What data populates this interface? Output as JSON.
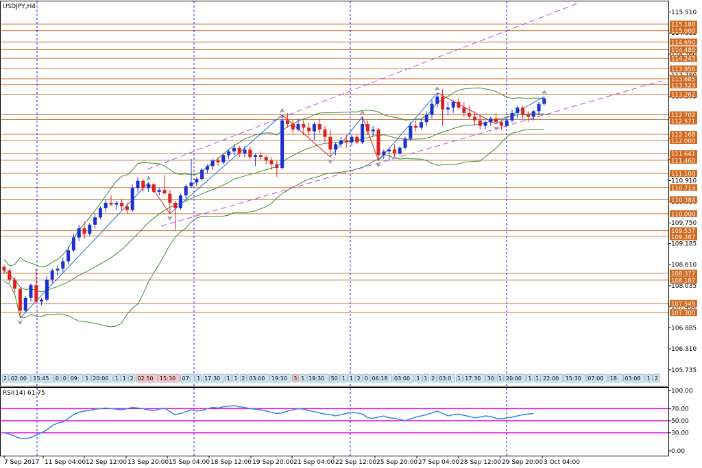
{
  "window": {
    "title": "USDJPY,H4",
    "rsi_label": "RSI(14) 61.75"
  },
  "colors": {
    "level_line": "#c87533",
    "level_label_bg": "#d2691e",
    "bull": "#1a2fd6",
    "bear": "#e0201f",
    "bands": "#3a8a2e",
    "channel": "#b04fd8",
    "zigzag_up": "#1e6fe0",
    "zigzag_down": "#d62020",
    "rsi": "#2f86e0",
    "rsi_levels": "#e000e0",
    "period_sep": "#1a1adc"
  },
  "chart_data": [
    {
      "type": "candlestick",
      "symbol": "USDJPY",
      "timeframe": "H4",
      "ylim": [
        105.3,
        115.8
      ],
      "y_ticks": [
        "115.510",
        "114.935",
        "114.360",
        "113.780",
        "113.205",
        "112.630",
        "112.055",
        "111.480",
        "110.910",
        "110.330",
        "109.750",
        "109.185",
        "108.610",
        "108.035",
        "107.460",
        "106.885",
        "106.310",
        "105.735"
      ],
      "x_ticks": [
        "7 Sep 2017",
        "11 Sep 04:00",
        "12 Sep 12:00",
        "13 Sep 20:00",
        "15 Sep 04:00",
        "18 Sep 12:00",
        "19 Sep 20:00",
        "21 Sep 04:00",
        "22 Sep 12:00",
        "25 Sep 20:00",
        "27 Sep 04:00",
        "28 Sep 12:00",
        "29 Sep 20:00",
        "3 Oct 04:00"
      ],
      "level_labels": [
        "115.180",
        "115.000",
        "114.690",
        "114.480",
        "114.243",
        "113.956",
        "113.685",
        "113.523",
        "113.262",
        "112.702",
        "112.571",
        "112.168",
        "112.000",
        "111.641",
        "111.460",
        "111.100",
        "110.713",
        "110.384",
        "110.000",
        "109.537",
        "109.387",
        "108.377",
        "108.187",
        "107.549",
        "107.300"
      ],
      "event_tags": [
        {
          "text": "2",
          "hi": false
        },
        {
          "text": "02:00",
          "hi": false
        },
        {
          "text": "15:45",
          "hi": false
        },
        {
          "text": "0",
          "hi": false
        },
        {
          "text": "0",
          "hi": false
        },
        {
          "text": "09:",
          "hi": false
        },
        {
          "text": "1",
          "hi": false
        },
        {
          "text": "20:00",
          "hi": false
        },
        {
          "text": "1",
          "hi": false
        },
        {
          "text": "1",
          "hi": false
        },
        {
          "text": "2",
          "hi": false
        },
        {
          "text": "02:50",
          "hi": true
        },
        {
          "text": "15:30",
          "hi": true
        },
        {
          "text": "07:",
          "hi": false
        },
        {
          "text": "1",
          "hi": false
        },
        {
          "text": "17:30",
          "hi": false
        },
        {
          "text": "1",
          "hi": false
        },
        {
          "text": "1",
          "hi": false
        },
        {
          "text": "2",
          "hi": false
        },
        {
          "text": "03:00",
          "hi": false
        },
        {
          "text": "19:30",
          "hi": false
        },
        {
          "text": "3",
          "hi": true
        },
        {
          "text": "1",
          "hi": false
        },
        {
          "text": "19:30",
          "hi": false
        },
        {
          "text": "50",
          "hi": false
        },
        {
          "text": "1",
          "hi": false
        },
        {
          "text": "1",
          "hi": false
        },
        {
          "text": "2",
          "hi": false
        },
        {
          "text": "0",
          "hi": false
        },
        {
          "text": "06:18",
          "hi": false
        },
        {
          "text": "03:00",
          "hi": false
        },
        {
          "text": "1",
          "hi": false
        },
        {
          "text": "1",
          "hi": false
        },
        {
          "text": "2",
          "hi": false
        },
        {
          "text": "03:0",
          "hi": false
        },
        {
          "text": "1",
          "hi": false
        },
        {
          "text": "17:30",
          "hi": false
        },
        {
          "text": "30",
          "hi": false
        },
        {
          "text": "1",
          "hi": false
        },
        {
          "text": "20:00",
          "hi": false
        },
        {
          "text": "1",
          "hi": false
        },
        {
          "text": "1",
          "hi": false
        },
        {
          "text": "22:00",
          "hi": false
        },
        {
          "text": "15:30",
          "hi": false
        },
        {
          "text": "07:00",
          "hi": false
        },
        {
          "text": "18:",
          "hi": false
        },
        {
          "text": "03:08",
          "hi": false
        },
        {
          "text": "1",
          "hi": false
        },
        {
          "text": "2",
          "hi": false
        },
        {
          "text": "03:08",
          "hi": false
        },
        {
          "text": "1",
          "hi": false
        },
        {
          "text": "23:30",
          "hi": false
        },
        {
          "text": "1",
          "hi": false
        },
        {
          "text": "2",
          "hi": false
        },
        {
          "text": "02:50",
          "hi": false
        },
        {
          "text": "17:",
          "hi": false
        },
        {
          "text": "03:08",
          "hi": false
        },
        {
          "text": "1",
          "hi": false
        },
        {
          "text": "22",
          "hi": false
        }
      ],
      "candles": [
        [
          108.55,
          108.6,
          108.35,
          108.45
        ],
        [
          108.45,
          108.5,
          108.1,
          108.2
        ],
        [
          108.2,
          108.25,
          107.85,
          107.95
        ],
        [
          107.95,
          108.0,
          107.15,
          107.35
        ],
        [
          107.35,
          107.75,
          107.3,
          107.7
        ],
        [
          107.7,
          108.1,
          107.6,
          108.05
        ],
        [
          108.05,
          108.5,
          107.95,
          107.6
        ],
        [
          107.6,
          107.7,
          107.5,
          107.65
        ],
        [
          107.65,
          108.3,
          107.6,
          108.2
        ],
        [
          108.2,
          108.5,
          108.1,
          108.45
        ],
        [
          108.45,
          108.6,
          108.3,
          108.5
        ],
        [
          108.5,
          108.8,
          108.4,
          108.7
        ],
        [
          108.7,
          109.1,
          108.6,
          109.0
        ],
        [
          109.0,
          109.45,
          108.95,
          109.35
        ],
        [
          109.35,
          109.7,
          109.25,
          109.6
        ],
        [
          109.6,
          109.8,
          109.3,
          109.45
        ],
        [
          109.45,
          109.75,
          109.4,
          109.7
        ],
        [
          109.7,
          110.0,
          109.6,
          109.9
        ],
        [
          109.9,
          110.2,
          109.85,
          110.15
        ],
        [
          110.15,
          110.4,
          110.05,
          110.3
        ],
        [
          110.3,
          110.5,
          110.2,
          110.25
        ],
        [
          110.25,
          110.35,
          110.1,
          110.3
        ],
        [
          110.3,
          110.4,
          110.1,
          110.2
        ],
        [
          110.2,
          110.3,
          110.0,
          110.1
        ],
        [
          110.1,
          110.8,
          110.05,
          110.7
        ],
        [
          110.7,
          111.0,
          110.6,
          110.9
        ],
        [
          110.9,
          110.95,
          110.6,
          110.7
        ],
        [
          110.7,
          110.85,
          110.6,
          110.8
        ],
        [
          110.8,
          110.85,
          110.55,
          110.6
        ],
        [
          110.6,
          110.7,
          110.5,
          110.65
        ],
        [
          110.65,
          111.05,
          110.55,
          110.55
        ],
        [
          110.55,
          110.65,
          110.0,
          110.3
        ],
        [
          110.3,
          110.35,
          109.55,
          110.15
        ],
        [
          110.15,
          110.55,
          110.1,
          110.5
        ],
        [
          110.5,
          110.8,
          110.4,
          110.75
        ],
        [
          110.75,
          111.5,
          110.7,
          110.85
        ],
        [
          110.85,
          111.0,
          110.75,
          110.95
        ],
        [
          110.95,
          111.25,
          110.9,
          111.2
        ],
        [
          111.2,
          111.35,
          111.1,
          111.3
        ],
        [
          111.3,
          111.5,
          111.2,
          111.45
        ],
        [
          111.45,
          111.55,
          111.3,
          111.4
        ],
        [
          111.4,
          111.65,
          111.35,
          111.6
        ],
        [
          111.6,
          111.75,
          111.5,
          111.7
        ],
        [
          111.7,
          111.9,
          111.6,
          111.8
        ],
        [
          111.8,
          111.85,
          111.55,
          111.65
        ],
        [
          111.65,
          111.85,
          111.55,
          111.75
        ],
        [
          111.75,
          111.85,
          111.5,
          111.55
        ],
        [
          111.55,
          111.65,
          111.3,
          111.6
        ],
        [
          111.6,
          111.7,
          111.5,
          111.55
        ],
        [
          111.55,
          111.6,
          111.35,
          111.45
        ],
        [
          111.45,
          111.55,
          111.2,
          111.35
        ],
        [
          111.35,
          111.45,
          111.0,
          111.25
        ],
        [
          111.25,
          112.7,
          111.2,
          112.55
        ],
        [
          112.55,
          112.75,
          112.35,
          112.45
        ],
        [
          112.45,
          112.55,
          112.2,
          112.3
        ],
        [
          112.3,
          112.6,
          112.25,
          112.45
        ],
        [
          112.45,
          112.6,
          112.15,
          112.35
        ],
        [
          112.35,
          112.5,
          112.1,
          112.25
        ],
        [
          112.25,
          112.5,
          112.0,
          112.45
        ],
        [
          112.45,
          112.6,
          112.2,
          112.3
        ],
        [
          112.3,
          112.4,
          111.95,
          112.1
        ],
        [
          112.1,
          112.3,
          111.55,
          111.75
        ],
        [
          111.75,
          111.95,
          111.6,
          111.9
        ],
        [
          111.9,
          112.1,
          111.8,
          112.0
        ],
        [
          112.0,
          112.15,
          111.8,
          111.95
        ],
        [
          111.95,
          112.15,
          111.85,
          112.1
        ],
        [
          112.1,
          112.15,
          111.9,
          111.95
        ],
        [
          111.95,
          112.65,
          111.9,
          112.45
        ],
        [
          112.45,
          112.55,
          112.15,
          112.25
        ],
        [
          112.25,
          112.4,
          112.1,
          112.3
        ],
        [
          112.3,
          112.35,
          111.45,
          111.6
        ],
        [
          111.6,
          111.75,
          111.5,
          111.7
        ],
        [
          111.7,
          111.8,
          111.45,
          111.75
        ],
        [
          111.75,
          111.9,
          111.55,
          111.65
        ],
        [
          111.65,
          111.85,
          111.6,
          111.8
        ],
        [
          111.8,
          112.1,
          111.75,
          112.05
        ],
        [
          112.05,
          112.5,
          112.0,
          112.4
        ],
        [
          112.4,
          112.55,
          112.25,
          112.35
        ],
        [
          112.35,
          112.6,
          112.3,
          112.5
        ],
        [
          112.5,
          112.8,
          112.4,
          112.7
        ],
        [
          112.7,
          113.1,
          112.6,
          113.0
        ],
        [
          113.0,
          113.3,
          112.9,
          113.2
        ],
        [
          113.2,
          113.4,
          112.4,
          112.85
        ],
        [
          112.85,
          113.05,
          112.7,
          112.9
        ],
        [
          112.9,
          113.1,
          112.75,
          113.05
        ],
        [
          113.05,
          113.15,
          112.85,
          112.9
        ],
        [
          112.9,
          113.05,
          112.65,
          112.75
        ],
        [
          112.75,
          112.95,
          112.6,
          112.65
        ],
        [
          112.65,
          112.8,
          112.4,
          112.55
        ],
        [
          112.55,
          112.7,
          112.3,
          112.4
        ],
        [
          112.4,
          112.55,
          112.3,
          112.5
        ],
        [
          112.5,
          112.65,
          112.4,
          112.6
        ],
        [
          112.6,
          112.75,
          112.45,
          112.5
        ],
        [
          112.5,
          112.55,
          112.3,
          112.4
        ],
        [
          112.4,
          112.6,
          112.35,
          112.55
        ],
        [
          112.55,
          112.85,
          112.5,
          112.75
        ],
        [
          112.75,
          112.95,
          112.6,
          112.9
        ],
        [
          112.9,
          112.95,
          112.6,
          112.7
        ],
        [
          112.7,
          112.8,
          112.5,
          112.65
        ],
        [
          112.65,
          112.85,
          112.55,
          112.8
        ],
        [
          112.8,
          113.05,
          112.7,
          113.0
        ],
        [
          113.0,
          113.2,
          112.95,
          113.15
        ]
      ],
      "series": [
        {
          "name": "Bollinger upper"
        },
        {
          "name": "Bollinger middle"
        },
        {
          "name": "Bollinger lower"
        }
      ],
      "channel_lines": [
        "upper",
        "lower"
      ],
      "horizontal_levels": [
        115.18,
        115.0,
        114.69,
        114.48,
        114.243,
        113.956,
        113.685,
        113.523,
        113.262,
        112.702,
        112.571,
        112.168,
        112.0,
        111.641,
        111.46,
        111.1,
        110.713,
        110.384,
        110.0,
        109.537,
        109.387,
        108.377,
        108.187,
        107.549,
        107.3
      ]
    },
    {
      "type": "line",
      "name": "RSI(14)",
      "ylim": [
        0,
        100
      ],
      "y_ticks": [
        "100.00",
        "70.00",
        "50.00",
        "30.00",
        "0.00"
      ],
      "levels": [
        70,
        50,
        30
      ],
      "last_value": 61.75,
      "values": [
        30,
        28,
        24,
        21,
        20,
        22,
        26,
        30,
        35,
        42,
        46,
        48,
        54,
        60,
        64,
        66,
        67,
        69,
        70,
        71,
        70,
        69,
        68,
        70,
        72,
        71,
        70,
        68,
        67,
        69,
        71,
        65,
        60,
        62,
        65,
        68,
        66,
        67,
        70,
        72,
        71,
        73,
        74,
        75,
        73,
        72,
        70,
        69,
        68,
        66,
        64,
        62,
        63,
        66,
        68,
        70,
        69,
        67,
        65,
        63,
        61,
        60,
        58,
        60,
        62,
        64,
        63,
        61,
        55,
        54,
        56,
        58,
        55,
        54,
        52,
        50,
        53,
        56,
        58,
        60,
        63,
        66,
        62,
        58,
        60,
        61,
        59,
        57,
        55,
        56,
        58,
        57,
        54,
        53,
        55,
        56,
        58,
        60,
        61,
        62
      ]
    }
  ]
}
